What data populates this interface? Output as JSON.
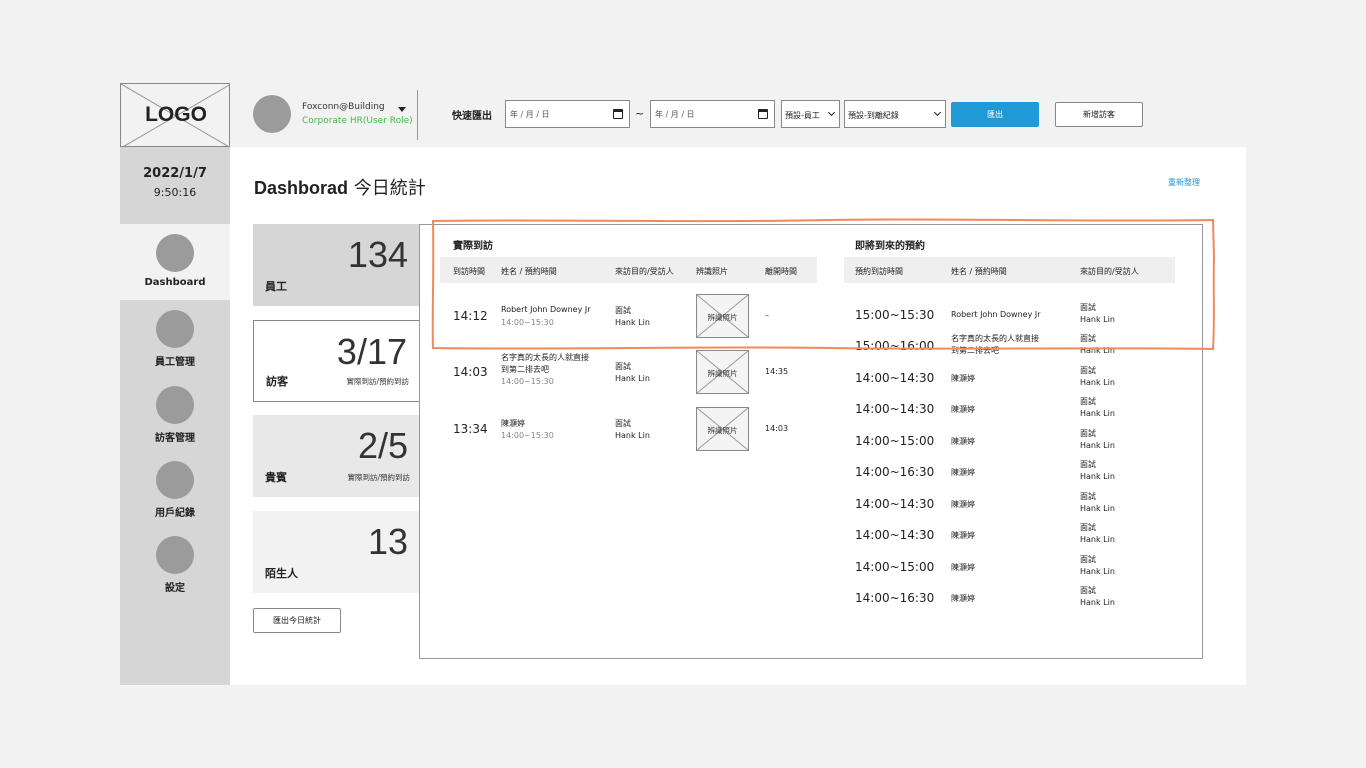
{
  "logo": {
    "text": "LOGO"
  },
  "account": {
    "name": "Foxconn@Building",
    "role": "Corporate HR(User Role)"
  },
  "quick_export": {
    "label": "快速匯出",
    "start_date_placeholder": "年 / 月 / 日",
    "end_date_placeholder": "年 / 月 / 日",
    "separator": "~",
    "select_type": "預設-員工",
    "select_record": "預設-到離紀錄",
    "export_label": "匯出",
    "new_visitor_label": "新增訪客"
  },
  "sidebar": {
    "date": "2022/1/7",
    "time": "9:50:16",
    "items": [
      {
        "label": "Dashboard"
      },
      {
        "label": "員工管理"
      },
      {
        "label": "訪客管理"
      },
      {
        "label": "用戶紀錄"
      },
      {
        "label": "設定"
      }
    ]
  },
  "page": {
    "title_en": "Dashborad",
    "title_zh": " 今日統計",
    "refresh_label": "重新整理"
  },
  "stats": [
    {
      "value": "134",
      "label": "員工",
      "sub": ""
    },
    {
      "value": "3/17",
      "label": "訪客",
      "sub": "實際到訪/預約到訪"
    },
    {
      "value": "2/5",
      "label": "貴賓",
      "sub": "實際到訪/預約到訪"
    },
    {
      "value": "13",
      "label": "陌生人",
      "sub": ""
    }
  ],
  "export_stats_label": "匯出今日統計",
  "actual_visits": {
    "title": "實際到訪",
    "headers": [
      "到訪時間",
      "姓名 / 預約時間",
      "來訪目的/受訪人",
      "辨識照片",
      "離開時間"
    ],
    "rows": [
      {
        "time": "14:12",
        "name_line1": "Robert John Downey Jr",
        "name_line2": "",
        "appt": "14:00~15:30",
        "purpose": "面試",
        "host": "Hank Lin",
        "photo": "辨識照片",
        "leave": "–"
      },
      {
        "time": "14:03",
        "name_line1": "名字真的太長的人就直接",
        "name_line2": "到第二排去吧",
        "appt": "14:00~15:30",
        "purpose": "面試",
        "host": "Hank Lin",
        "photo": "辨識照片",
        "leave": "14:35"
      },
      {
        "time": "13:34",
        "name_line1": "陳灝婷",
        "name_line2": "",
        "appt": "14:00~15:30",
        "purpose": "面試",
        "host": "Hank Lin",
        "photo": "辨識照片",
        "leave": "14:03"
      }
    ]
  },
  "upcoming": {
    "title": "即將到來的預約",
    "headers": [
      "預約到訪時間",
      "姓名 / 預約時間",
      "來訪目的/受訪人"
    ],
    "rows": [
      {
        "time": "15:00~15:30",
        "name_line1": "Robert John Downey Jr",
        "name_line2": "",
        "purpose": "面試",
        "host": "Hank Lin"
      },
      {
        "time": "15:00~16:00",
        "name_line1": "名字真的太長的人就直接",
        "name_line2": "到第二排去吧",
        "purpose": "面試",
        "host": "Hank Lin"
      },
      {
        "time": "14:00~14:30",
        "name_line1": "陳灝婷",
        "name_line2": "",
        "purpose": "面試",
        "host": "Hank Lin"
      },
      {
        "time": "14:00~14:30",
        "name_line1": "陳灝婷",
        "name_line2": "",
        "purpose": "面試",
        "host": "Hank Lin"
      },
      {
        "time": "14:00~15:00",
        "name_line1": "陳灝婷",
        "name_line2": "",
        "purpose": "面試",
        "host": "Hank Lin"
      },
      {
        "time": "14:00~16:30",
        "name_line1": "陳灝婷",
        "name_line2": "",
        "purpose": "面試",
        "host": "Hank Lin"
      },
      {
        "time": "14:00~14:30",
        "name_line1": "陳灝婷",
        "name_line2": "",
        "purpose": "面試",
        "host": "Hank Lin"
      },
      {
        "time": "14:00~14:30",
        "name_line1": "陳灝婷",
        "name_line2": "",
        "purpose": "面試",
        "host": "Hank Lin"
      },
      {
        "time": "14:00~15:00",
        "name_line1": "陳灝婷",
        "name_line2": "",
        "purpose": "面試",
        "host": "Hank Lin"
      },
      {
        "time": "14:00~16:30",
        "name_line1": "陳灝婷",
        "name_line2": "",
        "purpose": "面試",
        "host": "Hank Lin"
      }
    ]
  },
  "colors": {
    "accent": "#1f9ad6",
    "role_green": "#3fbf3f",
    "highlight_orange": "#f08a5d"
  }
}
